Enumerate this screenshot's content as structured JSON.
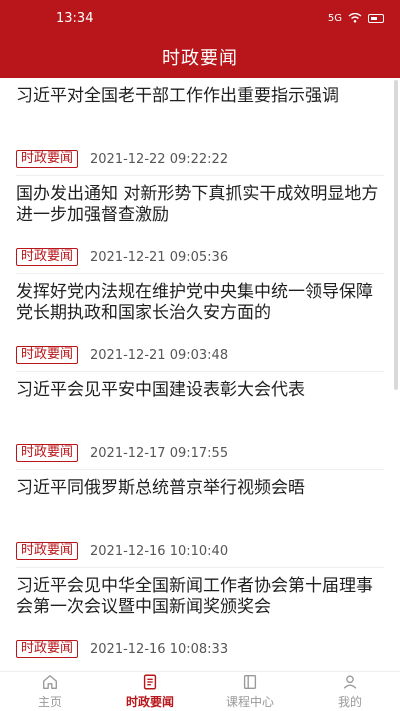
{
  "status_bar": {
    "time": "13:34",
    "network": "5G",
    "battery_icon": "battery-icon",
    "wifi_icon": "wifi-icon"
  },
  "header": {
    "title": "时政要闻"
  },
  "news": [
    {
      "title": "习近平对全国老干部工作作出重要指示强调",
      "tag": "时政要闻",
      "date": "2021-12-22 09:22:22"
    },
    {
      "title": "国办发出通知 对新形势下真抓实干成效明显地方进一步加强督查激励",
      "tag": "时政要闻",
      "date": "2021-12-21 09:05:36"
    },
    {
      "title": "发挥好党内法规在维护党中央集中统一领导保障党长期执政和国家长治久安方面的",
      "tag": "时政要闻",
      "date": "2021-12-21 09:03:48"
    },
    {
      "title": "习近平会见平安中国建设表彰大会代表",
      "tag": "时政要闻",
      "date": "2021-12-17 09:17:55"
    },
    {
      "title": "习近平同俄罗斯总统普京举行视频会晤",
      "tag": "时政要闻",
      "date": "2021-12-16 10:10:40"
    },
    {
      "title": "习近平会见中华全国新闻工作者协会第十届理事会第一次会议暨中国新闻奖颁奖会",
      "tag": "时政要闻",
      "date": "2021-12-16 10:08:33"
    }
  ],
  "tabs": [
    {
      "label": "主页",
      "icon": "home-icon"
    },
    {
      "label": "时政要闻",
      "icon": "news-icon"
    },
    {
      "label": "课程中心",
      "icon": "course-icon"
    },
    {
      "label": "我的",
      "icon": "profile-icon"
    }
  ],
  "colors": {
    "accent": "#b8161a"
  }
}
